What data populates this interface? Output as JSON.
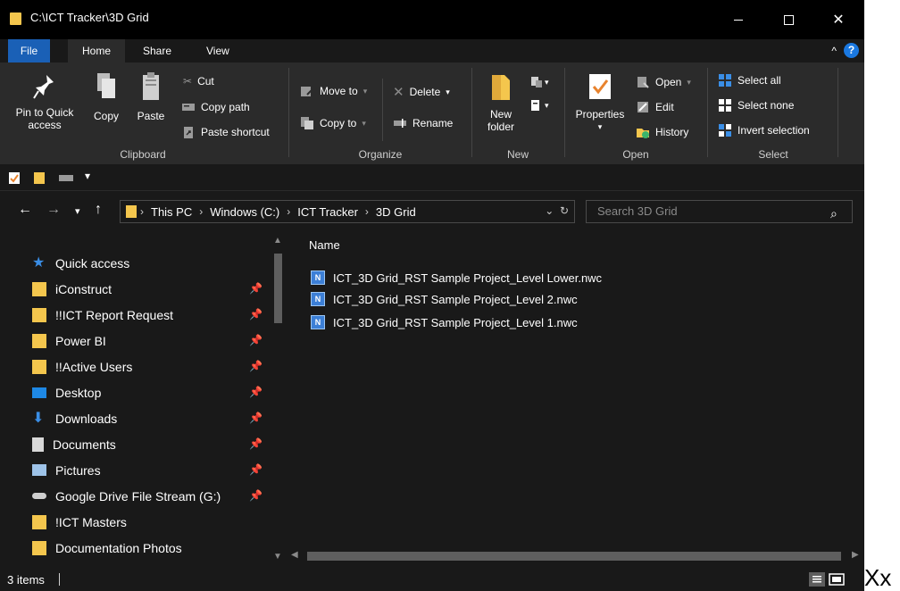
{
  "window": {
    "title": "C:\\ICT Tracker\\3D Grid"
  },
  "tabs": [
    {
      "label": "File"
    },
    {
      "label": "Home"
    },
    {
      "label": "Share"
    },
    {
      "label": "View"
    }
  ],
  "ribbon": {
    "clipboard": {
      "label": "Clipboard",
      "pin_to_quick_access_1": "Pin to Quick",
      "pin_to_quick_access_2": "access",
      "copy": "Copy",
      "paste": "Paste",
      "cut": "Cut",
      "copy_path": "Copy path",
      "paste_shortcut": "Paste shortcut"
    },
    "organize": {
      "label": "Organize",
      "move_to": "Move to",
      "copy_to": "Copy to",
      "delete": "Delete",
      "rename": "Rename"
    },
    "new": {
      "label": "New",
      "new_folder_1": "New",
      "new_folder_2": "folder"
    },
    "open": {
      "label": "Open",
      "properties": "Properties",
      "open": "Open",
      "edit": "Edit",
      "history": "History"
    },
    "select": {
      "label": "Select",
      "select_all": "Select all",
      "select_none": "Select none",
      "invert_selection": "Invert selection"
    }
  },
  "address": {
    "crumbs": [
      "This PC",
      "Windows (C:)",
      "ICT Tracker",
      "3D Grid"
    ],
    "search_placeholder": "Search 3D Grid"
  },
  "nav": {
    "quick_access": "Quick access",
    "items": [
      {
        "label": "iConstruct",
        "icon": "user-folder-icon",
        "pinned": true
      },
      {
        "label": "!!ICT Report Request",
        "icon": "user-folder-icon",
        "pinned": true
      },
      {
        "label": "Power BI",
        "icon": "user-folder-icon",
        "pinned": true
      },
      {
        "label": "!!Active Users",
        "icon": "user-folder-icon",
        "pinned": true
      },
      {
        "label": "Desktop",
        "icon": "desktop-icon",
        "pinned": true
      },
      {
        "label": "Downloads",
        "icon": "download-icon",
        "pinned": true
      },
      {
        "label": "Documents",
        "icon": "documents-icon",
        "pinned": true
      },
      {
        "label": "Pictures",
        "icon": "pictures-icon",
        "pinned": true
      },
      {
        "label": "Google Drive File Stream (G:)",
        "icon": "drive-icon",
        "pinned": true
      },
      {
        "label": "!ICT Masters",
        "icon": "user-folder-icon",
        "pinned": false
      },
      {
        "label": "Documentation Photos",
        "icon": "user-folder-icon",
        "pinned": false
      }
    ]
  },
  "content": {
    "column_name": "Name",
    "files": [
      {
        "name": "ICT_3D Grid_RST Sample Project_Level Lower.nwc"
      },
      {
        "name": "ICT_3D Grid_RST Sample Project_Level 2.nwc"
      },
      {
        "name": "ICT_3D Grid_RST Sample Project_Level 1.nwc"
      }
    ]
  },
  "status": {
    "item_count": "3 items"
  },
  "outside_text": "Xx",
  "colors": {
    "accent": "#1a60b6",
    "folder": "#f4c64d",
    "background": "#191919",
    "ribbon": "#2b2b2b"
  }
}
